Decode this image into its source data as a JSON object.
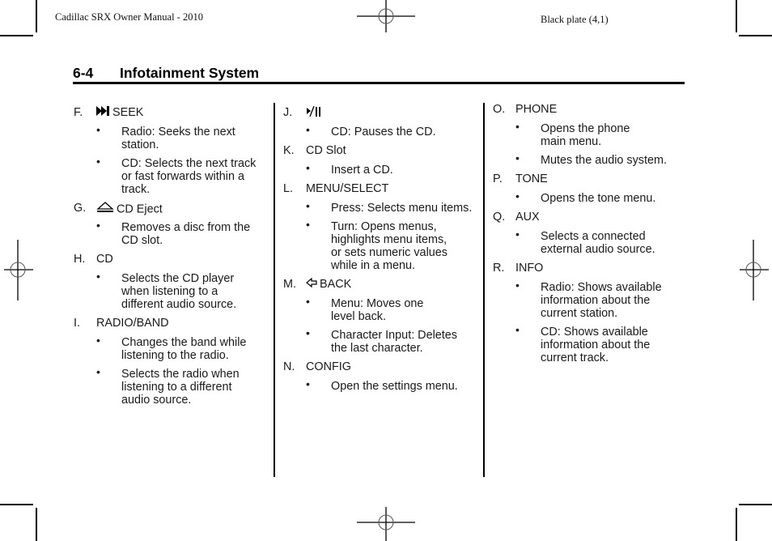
{
  "header": {
    "manual_title": "Cadillac SRX Owner Manual - 2010",
    "plate": "Black plate (4,1)"
  },
  "section": {
    "number": "6-4",
    "title": "Infotainment System"
  },
  "columns": [
    {
      "items": [
        {
          "letter": "F.",
          "icon": "seek-forward-icon",
          "label": "SEEK",
          "bullets": [
            "Radio: Seeks the next\nstation.",
            "CD: Selects the next track\nor fast forwards within a\ntrack."
          ]
        },
        {
          "letter": "G.",
          "icon": "eject-icon",
          "label": "CD Eject",
          "bullets": [
            "Removes a disc from the\nCD slot."
          ]
        },
        {
          "letter": "H.",
          "icon": "",
          "label": "CD",
          "bullets": [
            "Selects the CD player\nwhen listening to a\ndifferent audio source."
          ]
        },
        {
          "letter": "I.",
          "icon": "",
          "label": "RADIO/BAND",
          "bullets": [
            "Changes the band while\nlistening to the radio.",
            "Selects the radio when\nlistening to a different\naudio source."
          ]
        }
      ]
    },
    {
      "items": [
        {
          "letter": "J.",
          "icon": "play-pause-icon",
          "label": "",
          "bullets": [
            "CD: Pauses the CD."
          ]
        },
        {
          "letter": "K.",
          "icon": "",
          "label": "CD Slot",
          "bullets": [
            "Insert a CD."
          ]
        },
        {
          "letter": "L.",
          "icon": "",
          "label": "MENU/SELECT",
          "bullets": [
            "Press: Selects menu items.",
            "Turn: Opens menus,\nhighlights menu items,\nor sets numeric values\nwhile in a menu."
          ]
        },
        {
          "letter": "M.",
          "icon": "back-arrow-icon",
          "label": "BACK",
          "bullets": [
            "Menu: Moves one\nlevel back.",
            "Character Input: Deletes\nthe last character."
          ]
        },
        {
          "letter": "N.",
          "icon": "",
          "label": "CONFIG",
          "bullets": [
            "Open the settings menu."
          ]
        }
      ]
    },
    {
      "items": [
        {
          "letter": "O.",
          "icon": "",
          "label": "PHONE",
          "bullets": [
            "Opens the phone\nmain menu.",
            "Mutes the audio system."
          ]
        },
        {
          "letter": "P.",
          "icon": "",
          "label": "TONE",
          "bullets": [
            "Opens the tone menu."
          ]
        },
        {
          "letter": "Q.",
          "icon": "",
          "label": "AUX",
          "bullets": [
            "Selects a connected\nexternal audio source."
          ]
        },
        {
          "letter": "R.",
          "icon": "",
          "label": "INFO",
          "bullets": [
            "Radio: Shows available\ninformation about the\ncurrent station.",
            "CD: Shows available\ninformation about the\ncurrent track."
          ]
        }
      ]
    }
  ],
  "bullet_glyph": "•"
}
